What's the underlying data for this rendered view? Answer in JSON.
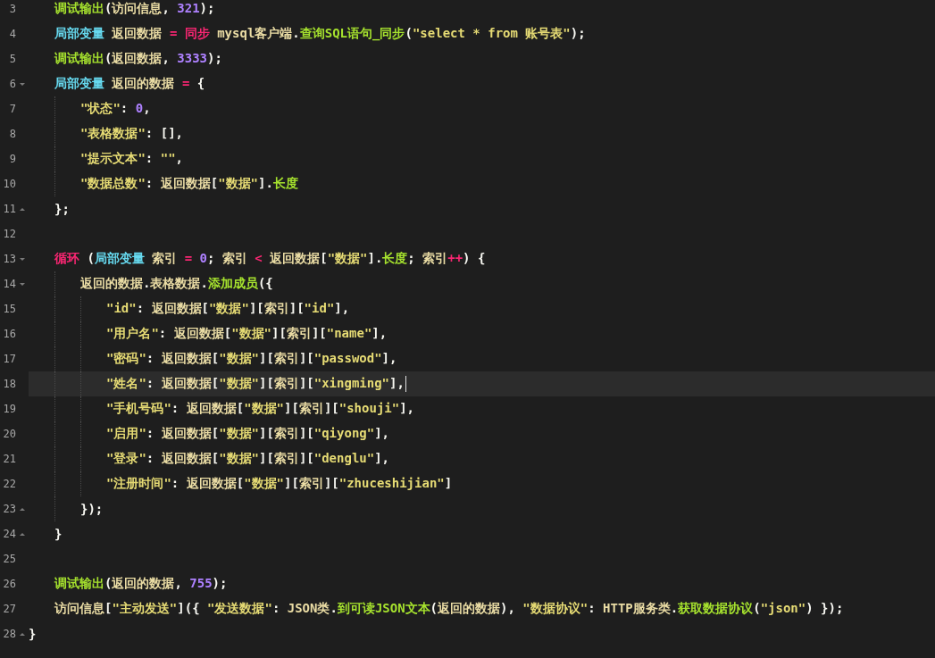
{
  "editor": {
    "lines": [
      {
        "children": [
          {
            "number": "3",
            "kind": "plain",
            "current": false,
            "tokens": [
              {
                "kind": "f",
                "t": "调试输出"
              },
              {
                "kind": "p",
                "t": "("
              },
              {
                "kind": "i",
                "t": "访问信息"
              },
              {
                "kind": "p",
                "t": ", "
              },
              {
                "kind": "n",
                "t": "321"
              },
              {
                "kind": "p",
                "t": ");"
              }
            ]
          },
          {
            "number": "4",
            "kind": "plain",
            "current": false,
            "tokens": [
              {
                "kind": "v",
                "t": "局部变量 "
              },
              {
                "kind": "i",
                "t": "返回数据 "
              },
              {
                "kind": "o",
                "t": "= 同步 "
              },
              {
                "kind": "i",
                "t": "mysql客户端"
              },
              {
                "kind": "p",
                "t": "."
              },
              {
                "kind": "f",
                "t": "查询SQL语句_同步"
              },
              {
                "kind": "p",
                "t": "("
              },
              {
                "kind": "s",
                "t": "\"select * from 账号表\""
              },
              {
                "kind": "p",
                "t": ");"
              }
            ]
          },
          {
            "number": "5",
            "kind": "plain",
            "current": false,
            "tokens": [
              {
                "kind": "f",
                "t": "调试输出"
              },
              {
                "kind": "p",
                "t": "("
              },
              {
                "kind": "i",
                "t": "返回数据"
              },
              {
                "kind": "p",
                "t": ", "
              },
              {
                "kind": "n",
                "t": "3333"
              },
              {
                "kind": "p",
                "t": ");"
              }
            ]
          },
          {
            "number": "6",
            "kind": "opener",
            "current": false,
            "tokens": [
              {
                "kind": "v",
                "t": "局部变量 "
              },
              {
                "kind": "i",
                "t": "返回的数据 "
              },
              {
                "kind": "o",
                "t": "= "
              },
              {
                "kind": "p",
                "t": "{"
              }
            ],
            "children": [
              {
                "number": "7",
                "kind": "plain",
                "current": false,
                "tokens": [
                  {
                    "kind": "s",
                    "t": "\"状态\""
                  },
                  {
                    "kind": "p",
                    "t": ": "
                  },
                  {
                    "kind": "n",
                    "t": "0"
                  },
                  {
                    "kind": "p",
                    "t": ","
                  }
                ]
              },
              {
                "number": "8",
                "kind": "plain",
                "current": false,
                "tokens": [
                  {
                    "kind": "s",
                    "t": "\"表格数据\""
                  },
                  {
                    "kind": "p",
                    "t": ": [],"
                  }
                ]
              },
              {
                "number": "9",
                "kind": "plain",
                "current": false,
                "tokens": [
                  {
                    "kind": "s",
                    "t": "\"提示文本\""
                  },
                  {
                    "kind": "p",
                    "t": ": "
                  },
                  {
                    "kind": "s",
                    "t": "\"\""
                  },
                  {
                    "kind": "p",
                    "t": ","
                  }
                ]
              },
              {
                "number": "10",
                "kind": "plain",
                "current": false,
                "tokens": [
                  {
                    "kind": "s",
                    "t": "\"数据总数\""
                  },
                  {
                    "kind": "p",
                    "t": ": "
                  },
                  {
                    "kind": "i",
                    "t": "返回数据"
                  },
                  {
                    "kind": "p",
                    "t": "["
                  },
                  {
                    "kind": "s",
                    "t": "\"数据\""
                  },
                  {
                    "kind": "p",
                    "t": "]."
                  },
                  {
                    "kind": "f",
                    "t": "长度"
                  }
                ]
              }
            ]
          },
          {
            "number": "11",
            "kind": "closer",
            "current": false,
            "tokens": [
              {
                "kind": "p",
                "t": "};"
              }
            ]
          },
          {
            "number": "12",
            "kind": "plain",
            "current": false
          },
          {
            "number": "13",
            "kind": "opener",
            "current": false,
            "tokens": [
              {
                "kind": "o",
                "t": "循环 "
              },
              {
                "kind": "p",
                "t": "("
              },
              {
                "kind": "v",
                "t": "局部变量 "
              },
              {
                "kind": "i",
                "t": "索引 "
              },
              {
                "kind": "o",
                "t": "= "
              },
              {
                "kind": "n",
                "t": "0"
              },
              {
                "kind": "p",
                "t": "; "
              },
              {
                "kind": "i",
                "t": "索引 "
              },
              {
                "kind": "o",
                "t": "< "
              },
              {
                "kind": "i",
                "t": "返回数据"
              },
              {
                "kind": "p",
                "t": "["
              },
              {
                "kind": "s",
                "t": "\"数据\""
              },
              {
                "kind": "p",
                "t": "]."
              },
              {
                "kind": "f",
                "t": "长度"
              },
              {
                "kind": "p",
                "t": "; "
              },
              {
                "kind": "i",
                "t": "索引"
              },
              {
                "kind": "o",
                "t": "++"
              },
              {
                "kind": "p",
                "t": ") {"
              }
            ],
            "children": [
              {
                "number": "14",
                "kind": "opener",
                "current": false,
                "tokens": [
                  {
                    "kind": "i",
                    "t": "返回的数据"
                  },
                  {
                    "kind": "p",
                    "t": "."
                  },
                  {
                    "kind": "i",
                    "t": "表格数据"
                  },
                  {
                    "kind": "p",
                    "t": "."
                  },
                  {
                    "kind": "f",
                    "t": "添加成员"
                  },
                  {
                    "kind": "p",
                    "t": "({"
                  }
                ],
                "children": [
                  {
                    "number": "15",
                    "kind": "plain",
                    "current": false,
                    "tokens": [
                      {
                        "kind": "s",
                        "t": "\"id\""
                      },
                      {
                        "kind": "p",
                        "t": ": "
                      },
                      {
                        "kind": "i",
                        "t": "返回数据"
                      },
                      {
                        "kind": "p",
                        "t": "["
                      },
                      {
                        "kind": "s",
                        "t": "\"数据\""
                      },
                      {
                        "kind": "p",
                        "t": "]["
                      },
                      {
                        "kind": "i",
                        "t": "索引"
                      },
                      {
                        "kind": "p",
                        "t": "]["
                      },
                      {
                        "kind": "s",
                        "t": "\"id\""
                      },
                      {
                        "kind": "p",
                        "t": "],"
                      }
                    ]
                  },
                  {
                    "number": "16",
                    "kind": "plain",
                    "current": false,
                    "tokens": [
                      {
                        "kind": "s",
                        "t": "\"用户名\""
                      },
                      {
                        "kind": "p",
                        "t": ": "
                      },
                      {
                        "kind": "i",
                        "t": "返回数据"
                      },
                      {
                        "kind": "p",
                        "t": "["
                      },
                      {
                        "kind": "s",
                        "t": "\"数据\""
                      },
                      {
                        "kind": "p",
                        "t": "]["
                      },
                      {
                        "kind": "i",
                        "t": "索引"
                      },
                      {
                        "kind": "p",
                        "t": "]["
                      },
                      {
                        "kind": "s",
                        "t": "\"name\""
                      },
                      {
                        "kind": "p",
                        "t": "],"
                      }
                    ]
                  },
                  {
                    "number": "17",
                    "kind": "plain",
                    "current": false,
                    "tokens": [
                      {
                        "kind": "s",
                        "t": "\"密码\""
                      },
                      {
                        "kind": "p",
                        "t": ": "
                      },
                      {
                        "kind": "i",
                        "t": "返回数据"
                      },
                      {
                        "kind": "p",
                        "t": "["
                      },
                      {
                        "kind": "s",
                        "t": "\"数据\""
                      },
                      {
                        "kind": "p",
                        "t": "]["
                      },
                      {
                        "kind": "i",
                        "t": "索引"
                      },
                      {
                        "kind": "p",
                        "t": "]["
                      },
                      {
                        "kind": "s",
                        "t": "\"passwod\""
                      },
                      {
                        "kind": "p",
                        "t": "],"
                      }
                    ]
                  },
                  {
                    "number": "18",
                    "kind": "plain",
                    "current": true,
                    "tokens": [
                      {
                        "kind": "s",
                        "t": "\"姓名\""
                      },
                      {
                        "kind": "p",
                        "t": ": "
                      },
                      {
                        "kind": "i",
                        "t": "返回数据"
                      },
                      {
                        "kind": "p",
                        "t": "["
                      },
                      {
                        "kind": "s",
                        "t": "\"数据\""
                      },
                      {
                        "kind": "p",
                        "t": "]["
                      },
                      {
                        "kind": "i",
                        "t": "索引"
                      },
                      {
                        "kind": "p",
                        "t": "]["
                      },
                      {
                        "kind": "s",
                        "t": "\"xingming\""
                      },
                      {
                        "kind": "p",
                        "t": "],"
                      }
                    ]
                  },
                  {
                    "number": "19",
                    "kind": "plain",
                    "current": false,
                    "tokens": [
                      {
                        "kind": "s",
                        "t": "\"手机号码\""
                      },
                      {
                        "kind": "p",
                        "t": ": "
                      },
                      {
                        "kind": "i",
                        "t": "返回数据"
                      },
                      {
                        "kind": "p",
                        "t": "["
                      },
                      {
                        "kind": "s",
                        "t": "\"数据\""
                      },
                      {
                        "kind": "p",
                        "t": "]["
                      },
                      {
                        "kind": "i",
                        "t": "索引"
                      },
                      {
                        "kind": "p",
                        "t": "]["
                      },
                      {
                        "kind": "s",
                        "t": "\"shouji\""
                      },
                      {
                        "kind": "p",
                        "t": "],"
                      }
                    ]
                  },
                  {
                    "number": "20",
                    "kind": "plain",
                    "current": false,
                    "tokens": [
                      {
                        "kind": "s",
                        "t": "\"启用\""
                      },
                      {
                        "kind": "p",
                        "t": ": "
                      },
                      {
                        "kind": "i",
                        "t": "返回数据"
                      },
                      {
                        "kind": "p",
                        "t": "["
                      },
                      {
                        "kind": "s",
                        "t": "\"数据\""
                      },
                      {
                        "kind": "p",
                        "t": "]["
                      },
                      {
                        "kind": "i",
                        "t": "索引"
                      },
                      {
                        "kind": "p",
                        "t": "]["
                      },
                      {
                        "kind": "s",
                        "t": "\"qiyong\""
                      },
                      {
                        "kind": "p",
                        "t": "],"
                      }
                    ]
                  },
                  {
                    "number": "21",
                    "kind": "plain",
                    "current": false,
                    "tokens": [
                      {
                        "kind": "s",
                        "t": "\"登录\""
                      },
                      {
                        "kind": "p",
                        "t": ": "
                      },
                      {
                        "kind": "i",
                        "t": "返回数据"
                      },
                      {
                        "kind": "p",
                        "t": "["
                      },
                      {
                        "kind": "s",
                        "t": "\"数据\""
                      },
                      {
                        "kind": "p",
                        "t": "]["
                      },
                      {
                        "kind": "i",
                        "t": "索引"
                      },
                      {
                        "kind": "p",
                        "t": "]["
                      },
                      {
                        "kind": "s",
                        "t": "\"denglu\""
                      },
                      {
                        "kind": "p",
                        "t": "],"
                      }
                    ]
                  },
                  {
                    "number": "22",
                    "kind": "plain",
                    "current": false,
                    "tokens": [
                      {
                        "kind": "s",
                        "t": "\"注册时间\""
                      },
                      {
                        "kind": "p",
                        "t": ": "
                      },
                      {
                        "kind": "i",
                        "t": "返回数据"
                      },
                      {
                        "kind": "p",
                        "t": "["
                      },
                      {
                        "kind": "s",
                        "t": "\"数据\""
                      },
                      {
                        "kind": "p",
                        "t": "]["
                      },
                      {
                        "kind": "i",
                        "t": "索引"
                      },
                      {
                        "kind": "p",
                        "t": "]["
                      },
                      {
                        "kind": "s",
                        "t": "\"zhuceshijian\""
                      },
                      {
                        "kind": "p",
                        "t": "]"
                      }
                    ]
                  }
                ]
              },
              {
                "number": "23",
                "kind": "closer",
                "current": false,
                "tokens": [
                  {
                    "kind": "p",
                    "t": "});"
                  }
                ]
              }
            ]
          },
          {
            "number": "24",
            "kind": "closer",
            "current": false,
            "tokens": [
              {
                "kind": "p",
                "t": "}"
              }
            ]
          },
          {
            "number": "25",
            "kind": "plain",
            "current": false
          },
          {
            "number": "26",
            "kind": "plain",
            "current": false,
            "tokens": [
              {
                "kind": "f",
                "t": "调试输出"
              },
              {
                "kind": "p",
                "t": "("
              },
              {
                "kind": "i",
                "t": "返回的数据"
              },
              {
                "kind": "p",
                "t": ", "
              },
              {
                "kind": "n",
                "t": "755"
              },
              {
                "kind": "p",
                "t": ");"
              }
            ]
          },
          {
            "number": "27",
            "kind": "plain",
            "current": false,
            "tokens": [
              {
                "kind": "i",
                "t": "访问信息"
              },
              {
                "kind": "p",
                "t": "["
              },
              {
                "kind": "s",
                "t": "\"主动发送\""
              },
              {
                "kind": "p",
                "t": "]({ "
              },
              {
                "kind": "s",
                "t": "\"发送数据\""
              },
              {
                "kind": "p",
                "t": ": "
              },
              {
                "kind": "i",
                "t": "JSON类"
              },
              {
                "kind": "p",
                "t": "."
              },
              {
                "kind": "f",
                "t": "到可读JSON文本"
              },
              {
                "kind": "p",
                "t": "("
              },
              {
                "kind": "i",
                "t": "返回的数据"
              },
              {
                "kind": "p",
                "t": "), "
              },
              {
                "kind": "s",
                "t": "\"数据协议\""
              },
              {
                "kind": "p",
                "t": ": "
              },
              {
                "kind": "i",
                "t": "HTTP服务类"
              },
              {
                "kind": "p",
                "t": "."
              },
              {
                "kind": "f",
                "t": "获取数据协议"
              },
              {
                "kind": "p",
                "t": "("
              },
              {
                "kind": "s",
                "t": "\"json\""
              },
              {
                "kind": "p",
                "t": ") });"
              }
            ]
          }
        ]
      },
      {
        "number": "28",
        "kind": "closer",
        "current": false,
        "tokens": [
          {
            "kind": "p",
            "t": "}"
          }
        ]
      }
    ]
  }
}
